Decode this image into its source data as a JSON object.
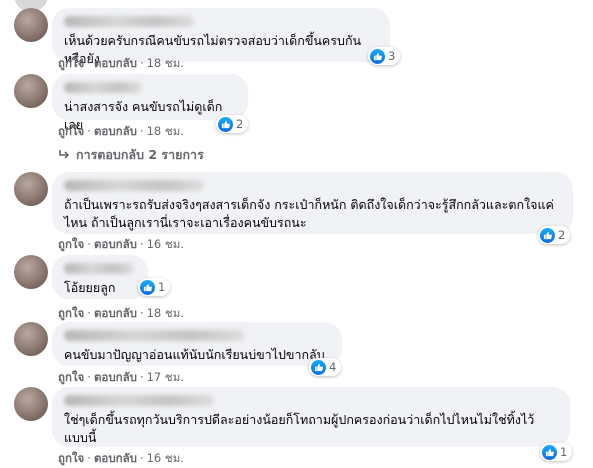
{
  "comments": [
    {
      "text": "เห็นด้วยครับกรณีคนขับรถไม่ตรวจสอบว่าเด็กขึ้นครบกันหรือยัง",
      "reactions": "3",
      "like": "ถูกใจ",
      "reply": "ตอบกลับ",
      "time": "18 ชม."
    },
    {
      "text": "น่าสงสารจัง คนขับรถไม่ดูเด็กเลย",
      "reactions": "2",
      "like": "ถูกใจ",
      "reply": "ตอบกลับ",
      "time": "18 ชม."
    },
    {
      "text_line1": "ถ้าเป็นเพราะรถรับส่งจริงๆสงสารเด็กจัง กระเป๋าก็หนัก ติดถึงใจเด็กว่าจะรู้สึกกลัวและตกใจแค่",
      "text_line2": "ไหน ถ้าเป็นลูกเรานี่เราจะเอาเรื่องคนขับรถนะ",
      "reactions": "2",
      "like": "ถูกใจ",
      "reply": "ตอบกลับ",
      "time": "16 ชม."
    },
    {
      "text": "โอ้ยยยลูก",
      "reactions": "1",
      "like": "ถูกใจ",
      "reply": "ตอบกลับ",
      "time": "18 ชม."
    },
    {
      "text": "คนขับมาปัญญาอ่อนแท้นับนักเรียนบ่ขาไปขากลับ",
      "reactions": "4",
      "like": "ถูกใจ",
      "reply": "ตอบกลับ",
      "time": "17 ชม."
    },
    {
      "text_line1": "ใช่ๆเด็กขึ้นรถทุกวันบริการปดีละอย่างน้อยก็โทถามผู้ปกครองก่อนว่าเด็กไปไหนไม่ใช่ทิ้งไว้",
      "text_line2": "แบบนี้",
      "reactions": "1",
      "like": "ถูกใจ",
      "reply": "ตอบกลับ",
      "time": "16 ชม."
    }
  ],
  "view_replies": "การตอบกลับ 2 รายการ",
  "colors": {
    "bubble": "#f0f2f5",
    "meta": "#65676b",
    "like_blue": "#1877f2"
  },
  "icons": {
    "like": "thumbs-up-icon",
    "reply_arrow": "reply-arrow-icon"
  }
}
